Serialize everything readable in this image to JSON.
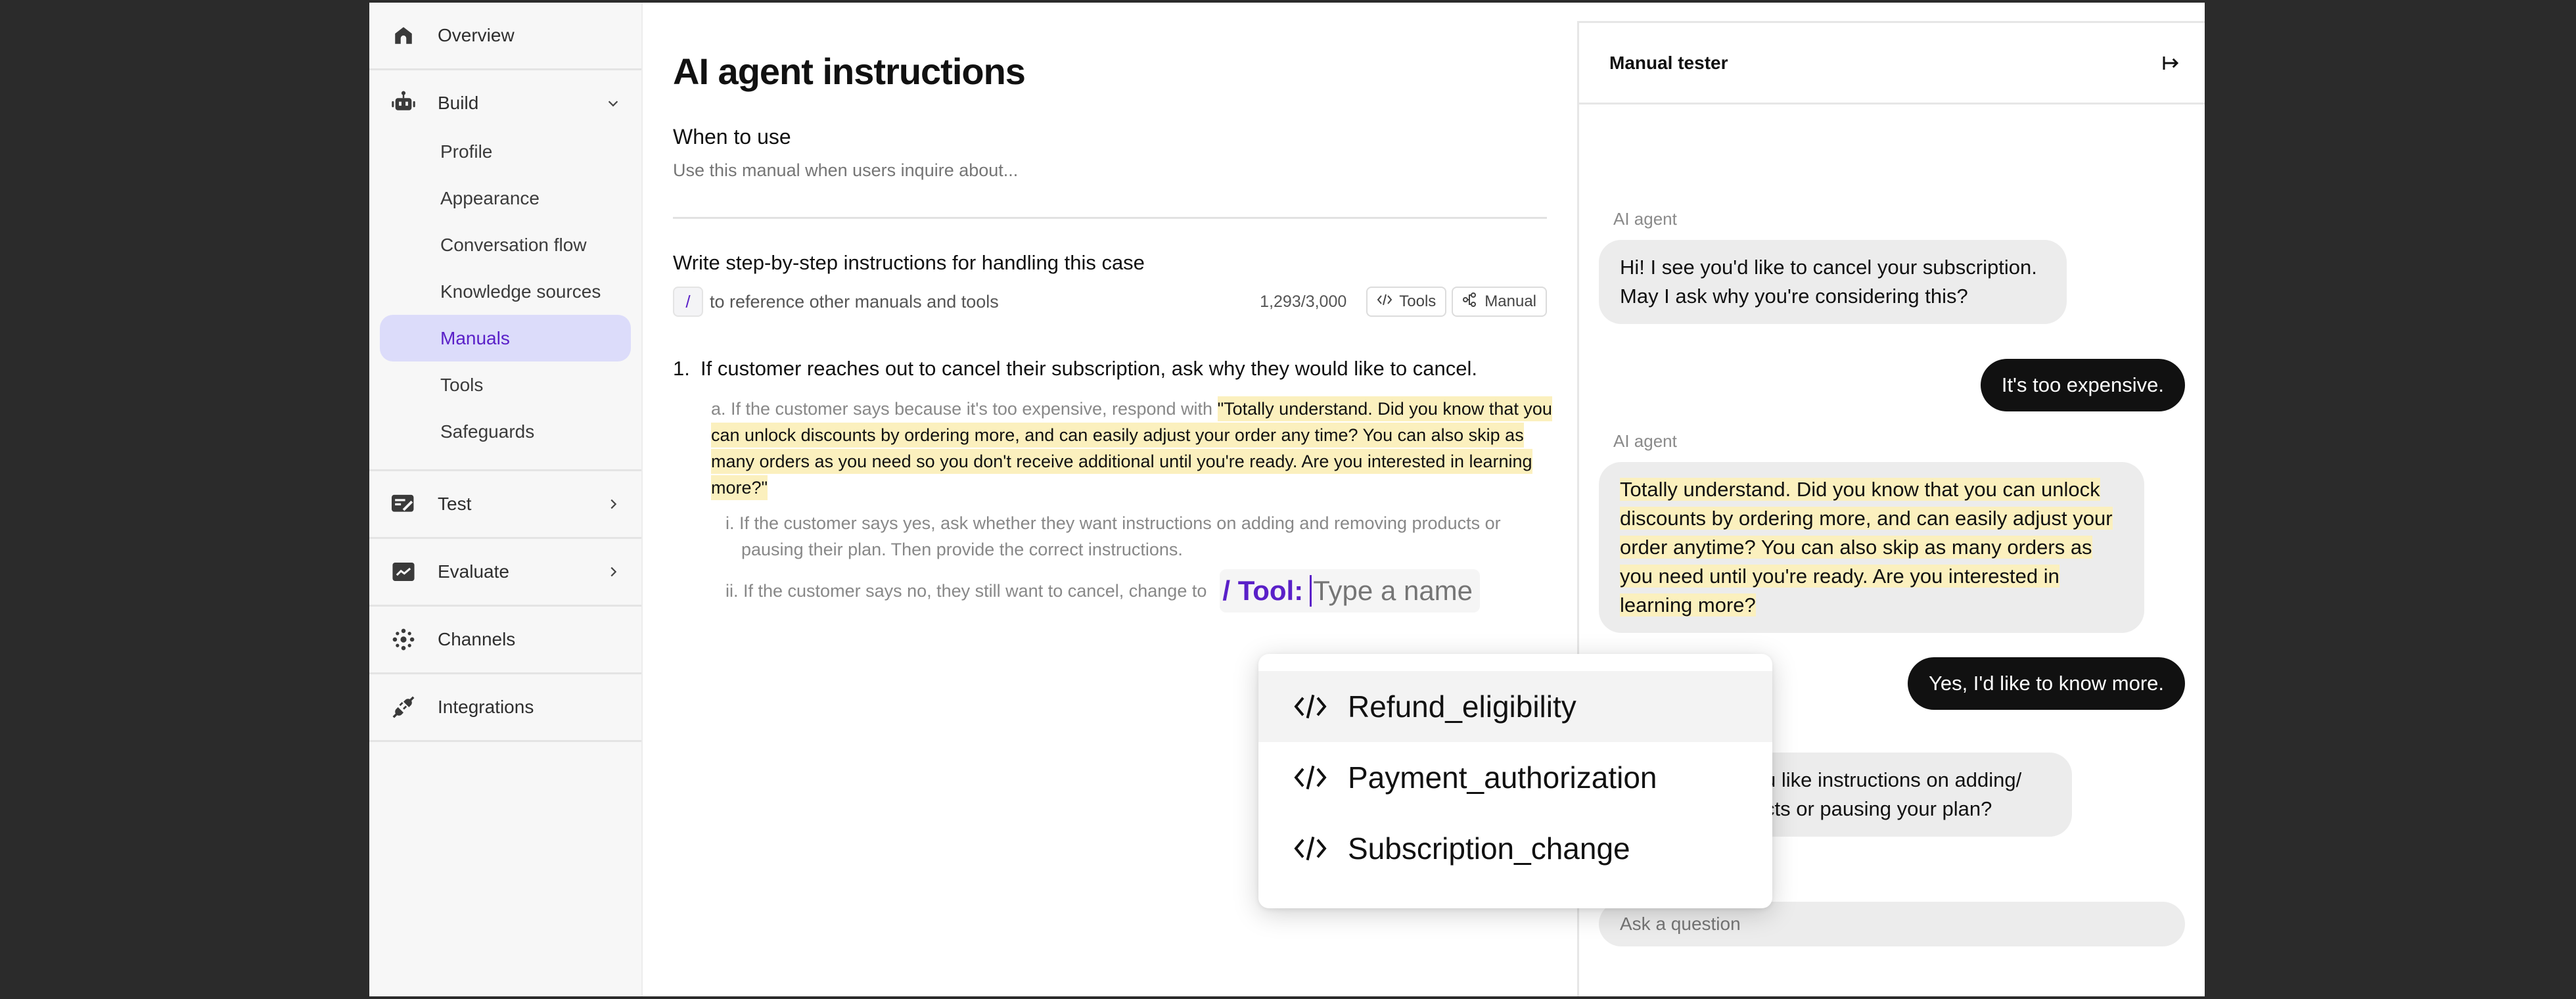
{
  "sidebar": {
    "overview": {
      "label": "Overview",
      "icon": "home-icon"
    },
    "build": {
      "label": "Build",
      "icon": "robot-icon",
      "expanded": true,
      "items": [
        {
          "label": "Profile",
          "active": false
        },
        {
          "label": "Appearance",
          "active": false
        },
        {
          "label": "Conversation flow",
          "active": false
        },
        {
          "label": "Knowledge sources",
          "active": false
        },
        {
          "label": "Manuals",
          "active": true
        },
        {
          "label": "Tools",
          "active": false
        },
        {
          "label": "Safeguards",
          "active": false
        }
      ]
    },
    "test": {
      "label": "Test",
      "icon": "test-edit-icon"
    },
    "evaluate": {
      "label": "Evaluate",
      "icon": "chart-trend-icon"
    },
    "channels": {
      "label": "Channels",
      "icon": "channels-dots-icon"
    },
    "integrations": {
      "label": "Integrations",
      "icon": "plug-icon"
    }
  },
  "main": {
    "title": "AI agent instructions",
    "when_to_use": {
      "label": "When to use",
      "placeholder": "Use this manual when users inquire about..."
    },
    "steps": {
      "label": "Write step-by-step instructions for handling this case",
      "helper_key": "/",
      "helper_text": "to reference other manuals and tools",
      "char_count": "1,293",
      "char_limit": "3,000",
      "char_sep": "/",
      "tools_button": "Tools",
      "manual_button": "Manual"
    },
    "instructions": {
      "step1_num": "1.",
      "step1_text": "If customer reaches out to cancel their subscription, ask why they would like to cancel.",
      "a_prefix": "a. If the customer says because it's too expensive, respond with ",
      "a_quote": "\"Totally understand. Did you know that you can unlock discounts by ordering more, and can easily adjust your order any time? You can also skip as many orders as you need so you don't receive additional until you're ready. Are you interested in learning more?\"",
      "i_text": "i. If the customer says yes, ask whether they want instructions on adding and removing products or pausing their plan. Then provide the correct instructions.",
      "ii_text": "ii. If the customer says no, they still want to cancel, change to",
      "tool_prefix": "/ Tool:",
      "tool_placeholder": "Type a name"
    }
  },
  "tool_dropdown": {
    "items": [
      {
        "label": "Refund_eligibility",
        "icon": "code-icon",
        "highlighted": true
      },
      {
        "label": "Payment_authorization",
        "icon": "code-icon",
        "highlighted": false
      },
      {
        "label": "Subscription_change",
        "icon": "code-icon",
        "highlighted": false
      }
    ]
  },
  "chat": {
    "title": "Manual tester",
    "messages": [
      {
        "role": "agent",
        "author": "AI agent",
        "text": "Hi! I see you'd like to cancel your subscription. May I ask why you're considering this?"
      },
      {
        "role": "user",
        "text": "It's too expensive."
      },
      {
        "role": "agent",
        "author": "AI agent",
        "text": "Totally understand. Did you know that you can unlock discounts by ordering more, and can easily adjust your order anytime? You can also skip as many orders as you need until you're ready. Are you interested in learning more?"
      },
      {
        "role": "user",
        "text": "Yes, I'd like to know more."
      },
      {
        "role": "agent",
        "text_visible_line1": "u like instructions on adding/",
        "text_visible_line2": "cts or pausing your plan?"
      }
    ],
    "input_placeholder": "Ask a question"
  },
  "colors": {
    "accent": "#5a20c8",
    "active_nav_bg": "#dcdcfa",
    "highlight": "#fbf0be",
    "user_bubble": "#111111",
    "agent_bubble": "#ececec"
  }
}
